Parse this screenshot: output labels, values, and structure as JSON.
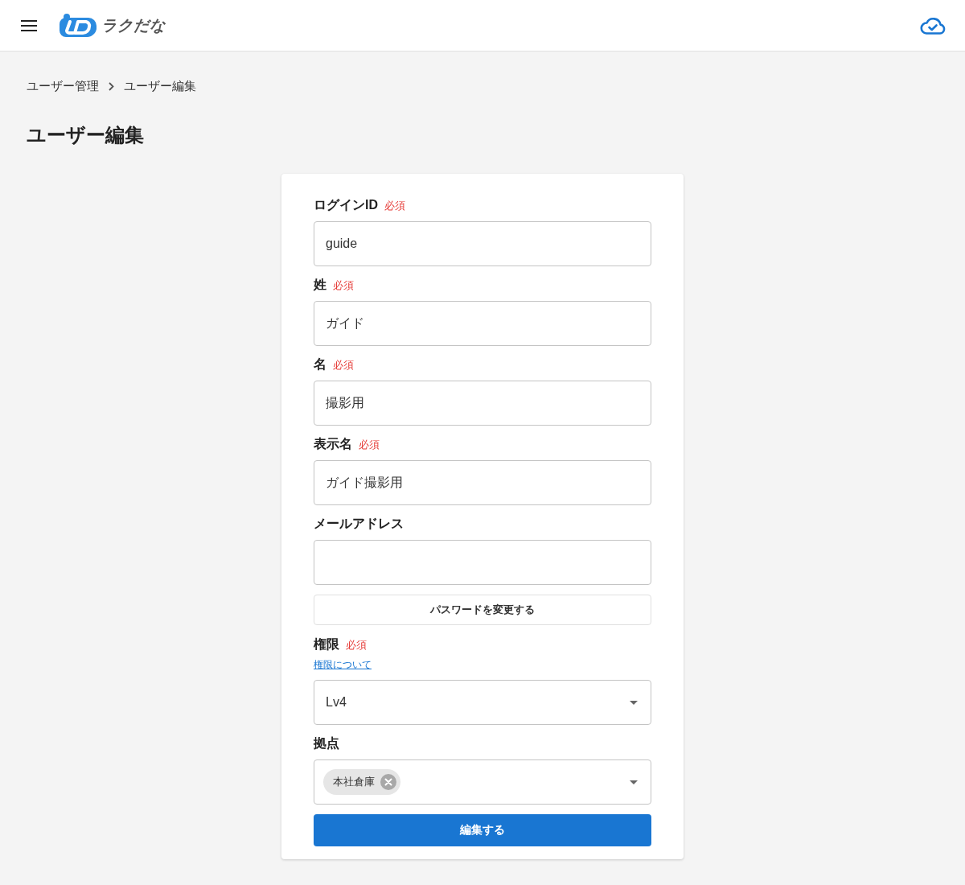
{
  "header": {
    "logo_text": "ラクだな"
  },
  "breadcrumb": [
    "ユーザー管理",
    "ユーザー編集"
  ],
  "page_title": "ユーザー編集",
  "form": {
    "fields": [
      {
        "kind": "text",
        "label": "ログインID",
        "required_mark": "必須",
        "value": "guide"
      },
      {
        "kind": "text",
        "label": "姓",
        "required_mark": "必須",
        "value": "ガイド"
      },
      {
        "kind": "text",
        "label": "名",
        "required_mark": "必須",
        "value": "撮影用"
      },
      {
        "kind": "text",
        "label": "表示名",
        "required_mark": "必須",
        "value": "ガイド撮影用"
      },
      {
        "kind": "text",
        "label": "メールアドレス"
      },
      {
        "kind": "button",
        "label": "パスワードを変更する"
      },
      {
        "kind": "select",
        "label": "権限",
        "required_mark": "必須",
        "help_link": "権限について",
        "value": "Lv4"
      },
      {
        "kind": "multiselect",
        "label": "拠点",
        "chips": [
          {
            "label": "本社倉庫"
          }
        ]
      }
    ],
    "submit": "編集する"
  }
}
